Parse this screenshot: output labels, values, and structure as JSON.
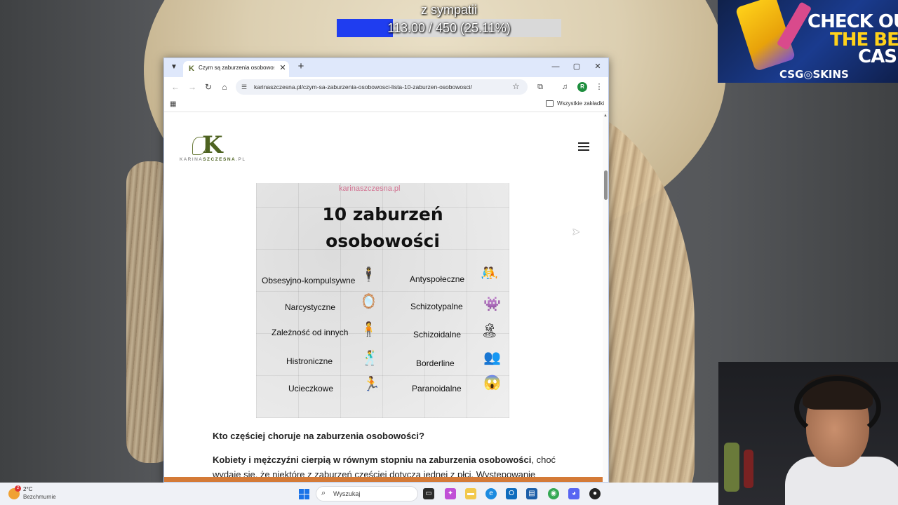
{
  "stream": {
    "goal": {
      "title": "z sympatii",
      "text": "113.00 / 450 (25.11%)",
      "progress": 0.2511
    },
    "ad": {
      "line1": "CHECK OU",
      "line2": "THE BES",
      "line3": "CASE",
      "brand": "CSG◎SKINS"
    }
  },
  "browser": {
    "tab": {
      "title": "Czym są zaburzenia osobowości",
      "favicon": "K"
    },
    "url": "karinaszczesna.pl/czym-sa-zaburzenia-osobowosci-lista-10-zaburzen-osobowosci/",
    "profile_initial": "R",
    "bookmarks_label": "Wszystkie zakładki"
  },
  "page": {
    "logo": {
      "letter": "K",
      "text_a": "KARINA",
      "text_b": "SZCZESNA",
      "text_c": ".PL"
    },
    "infographic": {
      "brand": "karinaszczesna.pl",
      "title_line1": "10 zaburzeń",
      "title_line2": "osobowości",
      "items_left": [
        "Obsesyjno-kompulsywne",
        "Narcystyczne",
        "Zależność od innych",
        "Histroniczne",
        "Ucieczkowe"
      ],
      "items_right": [
        "Antyspołeczne",
        "Schizotypalne",
        "Schizoidalne",
        "Borderline",
        "Paranoidalne"
      ]
    },
    "question": "Kto częściej choruje na zaburzenia osobowości?",
    "paragraph_bold": "Kobiety i mężczyźni cierpią w równym stopniu na zaburzenia osobowości",
    "paragraph_rest": ", choć wydaje się, że niektóre z zaburzeń częściej dotyczą jednej z płci. Występowanie"
  },
  "taskbar": {
    "weather_temp": "2°C",
    "weather_desc": "Bezchmurnie",
    "weather_badge": "2",
    "search_placeholder": "Wyszukaj"
  }
}
